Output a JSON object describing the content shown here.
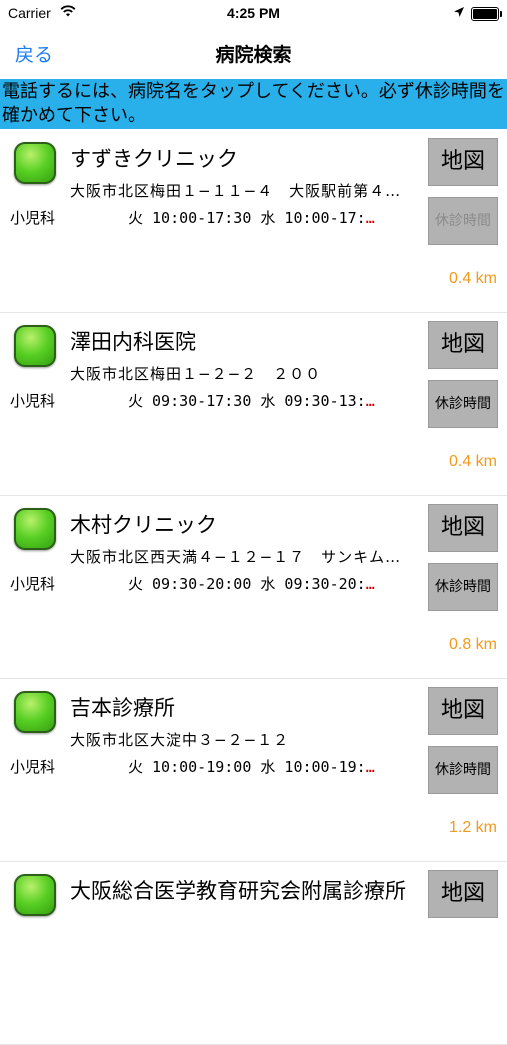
{
  "status_bar": {
    "carrier": "Carrier",
    "time": "4:25 PM",
    "icons": [
      "wifi-icon",
      "location-arrow-icon",
      "battery-icon"
    ]
  },
  "navbar": {
    "back_label": "戻る",
    "title": "病院検索"
  },
  "notice": "電話するには、病院名をタップしてください。必ず休診時間を確かめて下さい。",
  "hospitals": [
    {
      "name": "すずきクリニック",
      "address": "大阪市北区梅田１−１１−４　大阪駅前第４…",
      "department": "小児科",
      "hours": "火 10:00-17:30  水 10:00-17:",
      "hours_tail": "…",
      "map_label": "地図",
      "closed_label": "休診時間",
      "closed_disabled": true,
      "distance": "0.4 km"
    },
    {
      "name": "澤田内科医院",
      "address": "大阪市北区梅田１−２−２　２００",
      "department": "小児科",
      "hours": "火 09:30-17:30  水 09:30-13:",
      "hours_tail": "…",
      "map_label": "地図",
      "closed_label": "休診時間",
      "closed_disabled": false,
      "distance": "0.4 km"
    },
    {
      "name": "木村クリニック",
      "address": "大阪市北区西天満４−１２−１７　サンキム…",
      "department": "小児科",
      "hours": "火 09:30-20:00  水 09:30-20:",
      "hours_tail": "…",
      "map_label": "地図",
      "closed_label": "休診時間",
      "closed_disabled": false,
      "distance": "0.8 km"
    },
    {
      "name": "吉本診療所",
      "address": "大阪市北区大淀中３−２−１２",
      "department": "小児科",
      "hours": "火 10:00-19:00  水 10:00-19:",
      "hours_tail": "…",
      "map_label": "地図",
      "closed_label": "休診時間",
      "closed_disabled": false,
      "distance": "1.2 km"
    },
    {
      "name": "大阪総合医学教育研究会附属診療所",
      "address": "",
      "department": "",
      "hours": "",
      "hours_tail": "",
      "map_label": "地図",
      "closed_label": "",
      "closed_disabled": false,
      "distance": ""
    }
  ],
  "colors": {
    "accent": "#1a7cf5",
    "notice_bg": "#29b0ea",
    "distance": "#f39a1e",
    "status_green": "#58cf24",
    "button_bg": "#b2b2b2"
  }
}
